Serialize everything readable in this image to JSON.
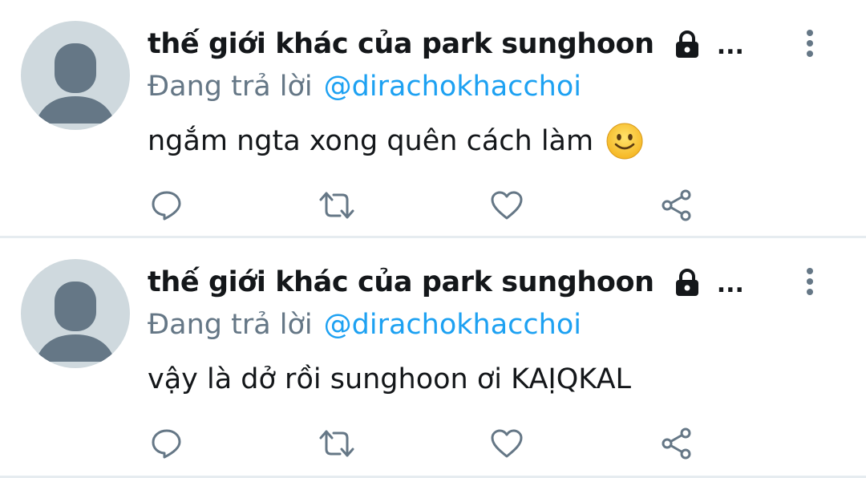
{
  "colors": {
    "text_primary": "#14171a",
    "text_secondary": "#657786",
    "link": "#1da1f2",
    "icon": "#657786",
    "divider": "#e6ecf0",
    "avatar_bg": "#cfd9de",
    "avatar_fg": "#657786"
  },
  "tweets": [
    {
      "display_name": "thế giới khác của park sunghoon",
      "ellipsis": "...",
      "reply_prefix": "Đang trả lời",
      "reply_handle": "@dirachokhacchoi",
      "text": "ngắm ngta xong quên cách làm",
      "emoji": "slightly-smiling-face-icon",
      "icons": [
        "reply-icon",
        "retweet-icon",
        "like-icon",
        "share-icon",
        "lock-icon",
        "more-vertical-icon"
      ]
    },
    {
      "display_name": "thế giới khác của park sunghoon",
      "ellipsis": "...",
      "reply_prefix": "Đang trả lời",
      "reply_handle": "@dirachokhacchoi",
      "text": "vậy là dở rồi sunghoon ơi KAỊQKAL",
      "icons": [
        "reply-icon",
        "retweet-icon",
        "like-icon",
        "share-icon",
        "lock-icon",
        "more-vertical-icon"
      ]
    }
  ]
}
